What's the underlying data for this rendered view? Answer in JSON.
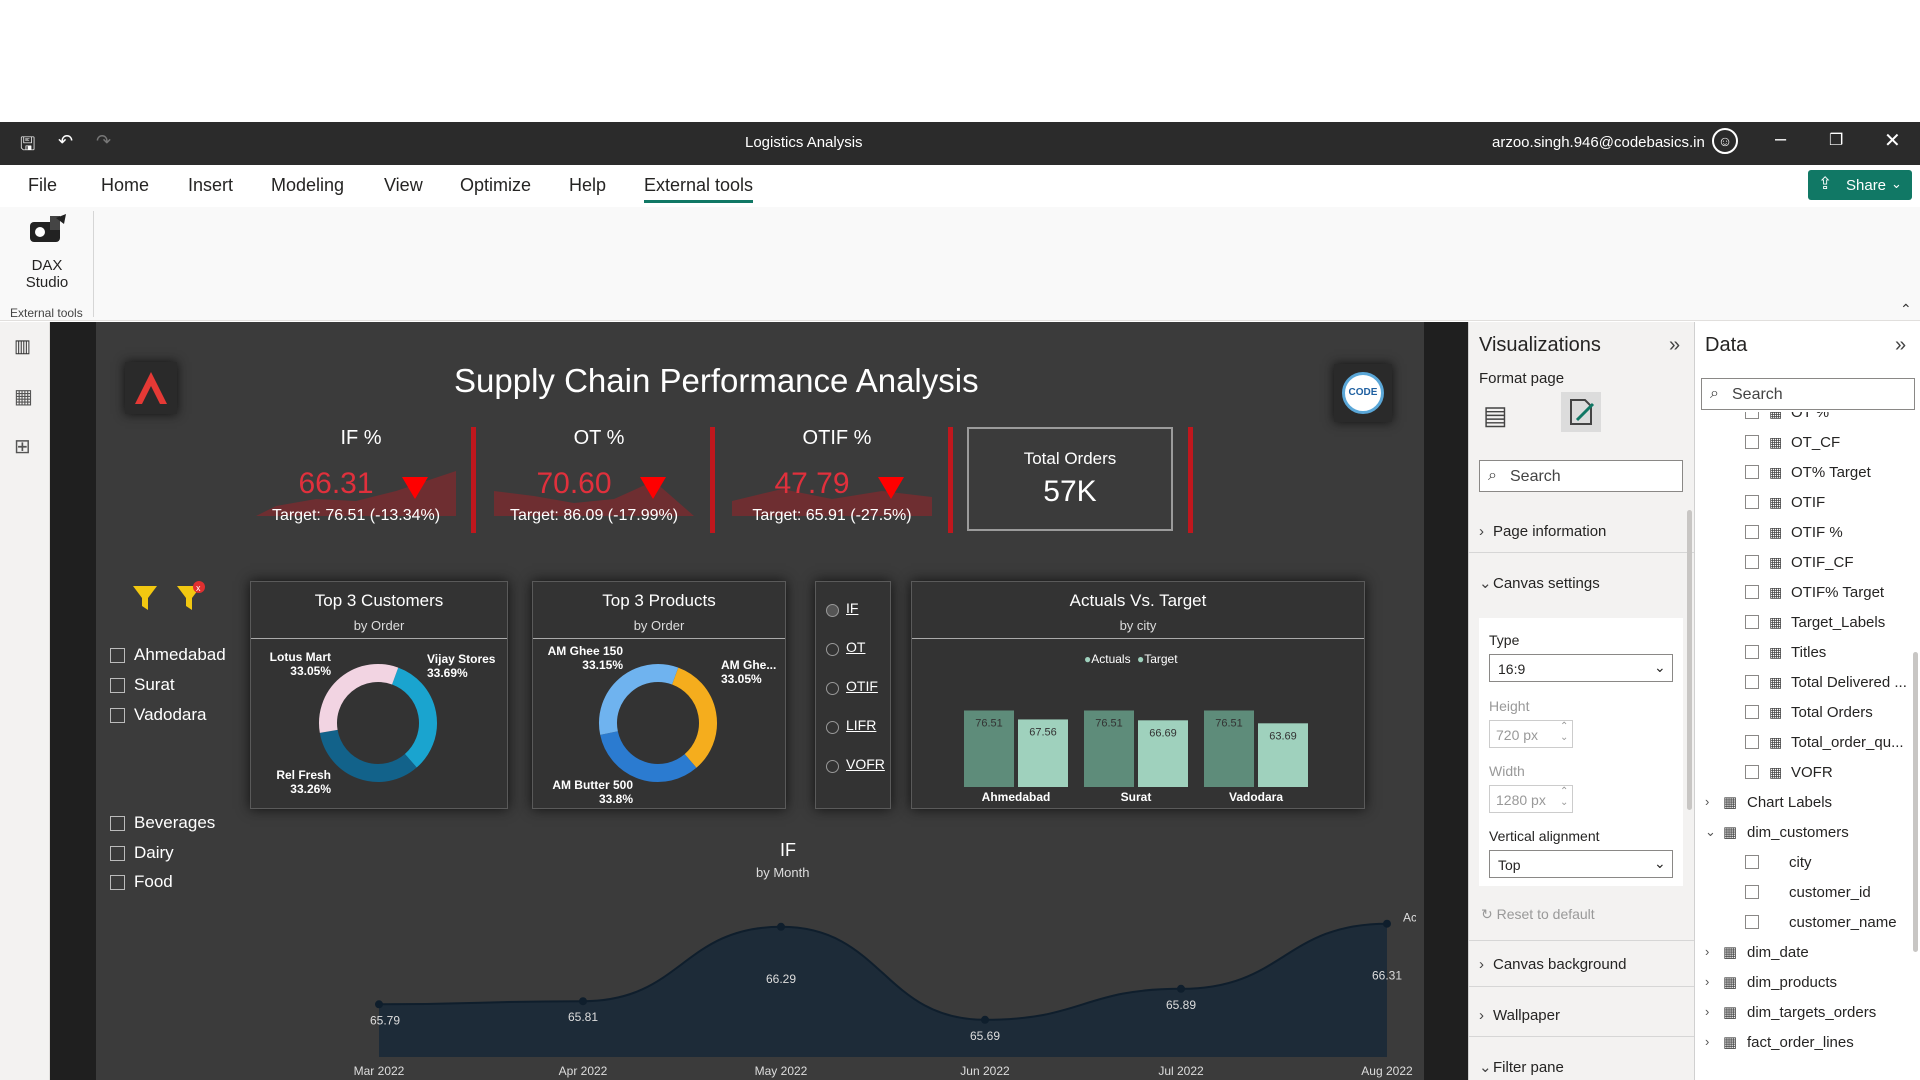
{
  "window": {
    "title": "Logistics Analysis",
    "user": "arzoo.singh.946@codebasics.in",
    "share_label": "Share"
  },
  "ribbon": {
    "tabs": [
      "File",
      "Home",
      "Insert",
      "Modeling",
      "View",
      "Optimize",
      "Help",
      "External tools"
    ],
    "active_tab": "External tools",
    "tool_label_line1": "DAX",
    "tool_label_line2": "Studio",
    "group_label": "External tools"
  },
  "report": {
    "title": "Supply Chain Performance Analysis",
    "kpis": [
      {
        "title": "IF %",
        "value": "66.31",
        "target": "Target: 76.51 (-13.34%)"
      },
      {
        "title": "OT %",
        "value": "70.60",
        "target": "Target: 86.09 (-17.99%)"
      },
      {
        "title": "OTIF %",
        "value": "47.79",
        "target": "Target: 65.91 (-27.5%)"
      }
    ],
    "total_orders": {
      "label": "Total Orders",
      "value": "57K"
    },
    "city_slicer": [
      "Ahmedabad",
      "Surat",
      "Vadodara"
    ],
    "category_slicer": [
      "Beverages",
      "Dairy",
      "Food"
    ],
    "metric_selector": [
      "IF",
      "OT",
      "OTIF",
      "LIFR",
      "VOFR"
    ],
    "top_customers": {
      "title": "Top 3 Customers",
      "subtitle": "by Order",
      "slices": [
        {
          "name": "Lotus Mart",
          "pct": "33.05%",
          "value": 33.05,
          "color": "#1aa4cf"
        },
        {
          "name": "Vijay Stores",
          "pct": "33.69%",
          "value": 33.69,
          "color": "#12628a"
        },
        {
          "name": "Rel Fresh",
          "pct": "33.26%",
          "value": 33.26,
          "color": "#f2d4e2"
        }
      ]
    },
    "top_products": {
      "title": "Top 3 Products",
      "subtitle": "by Order",
      "slices": [
        {
          "name": "AM Ghee 150",
          "pct": "33.15%",
          "value": 33.15,
          "color": "#f5ad1d"
        },
        {
          "name": "AM Ghe...",
          "pct": "33.05%",
          "value": 33.05,
          "color": "#2b7bd0"
        },
        {
          "name": "AM Butter 500",
          "pct": "33.8%",
          "value": 33.8,
          "color": "#6fb3ef"
        }
      ]
    },
    "actual_vs_target": {
      "title": "Actuals Vs. Target",
      "subtitle": "by city",
      "legend": [
        "Actuals",
        "Target"
      ],
      "colors": {
        "Actuals": "#5e8c7a",
        "Target": "#9fd1bd"
      }
    },
    "line_title": "IF",
    "line_subtitle": "by Month",
    "line_series_label": "Actual"
  },
  "chart_data": [
    {
      "type": "bar",
      "title": "Actuals Vs. Target",
      "subtitle": "by city",
      "categories": [
        "Ahmedabad",
        "Surat",
        "Vadodara"
      ],
      "series": [
        {
          "name": "Actuals",
          "values": [
            76.51,
            76.51,
            76.51
          ]
        },
        {
          "name": "Target",
          "values": [
            67.56,
            66.69,
            63.69
          ]
        }
      ],
      "legend": "top-center"
    },
    {
      "type": "area",
      "title": "IF",
      "subtitle": "by Month",
      "x": [
        "Mar 2022",
        "Apr 2022",
        "May 2022",
        "Jun 2022",
        "Jul 2022",
        "Aug 2022"
      ],
      "series": [
        {
          "name": "Actual",
          "values": [
            65.79,
            65.81,
            66.29,
            65.69,
            65.89,
            66.31
          ]
        }
      ],
      "ylim": [
        65.45,
        66.45
      ]
    },
    {
      "type": "pie",
      "title": "Top 3 Customers",
      "subtitle": "by Order",
      "categories": [
        "Lotus Mart",
        "Vijay Stores",
        "Rel Fresh"
      ],
      "values": [
        33.05,
        33.69,
        33.26
      ]
    },
    {
      "type": "pie",
      "title": "Top 3 Products",
      "subtitle": "by Order",
      "categories": [
        "AM Ghee 150",
        "AM Ghe...",
        "AM Butter 500"
      ],
      "values": [
        33.15,
        33.05,
        33.8
      ]
    }
  ],
  "viz_pane": {
    "title": "Visualizations",
    "subtitle": "Format page",
    "search_placeholder": "Search",
    "sections": {
      "page_information": "Page information",
      "canvas_settings": "Canvas settings",
      "type_label": "Type",
      "type_value": "16:9",
      "height_label": "Height",
      "height_value": "720 px",
      "width_label": "Width",
      "width_value": "1280 px",
      "valign_label": "Vertical alignment",
      "valign_value": "Top",
      "reset": "Reset to default",
      "canvas_background": "Canvas background",
      "wallpaper": "Wallpaper",
      "filter_pane": "Filter pane"
    }
  },
  "data_pane": {
    "title": "Data",
    "search_placeholder": "Search",
    "measures": [
      "OT %",
      "OT_CF",
      "OT% Target",
      "OTIF",
      "OTIF %",
      "OTIF_CF",
      "OTIF% Target",
      "Target_Labels",
      "Titles",
      "Total Delivered ...",
      "Total Orders",
      "Total_order_qu...",
      "VOFR"
    ],
    "tables_top": [
      "Chart Labels",
      "dim_customers"
    ],
    "customer_fields": [
      "city",
      "customer_id",
      "customer_name"
    ],
    "tables_bottom": [
      "dim_date",
      "dim_products",
      "dim_targets_orders",
      "fact_order_lines"
    ]
  }
}
